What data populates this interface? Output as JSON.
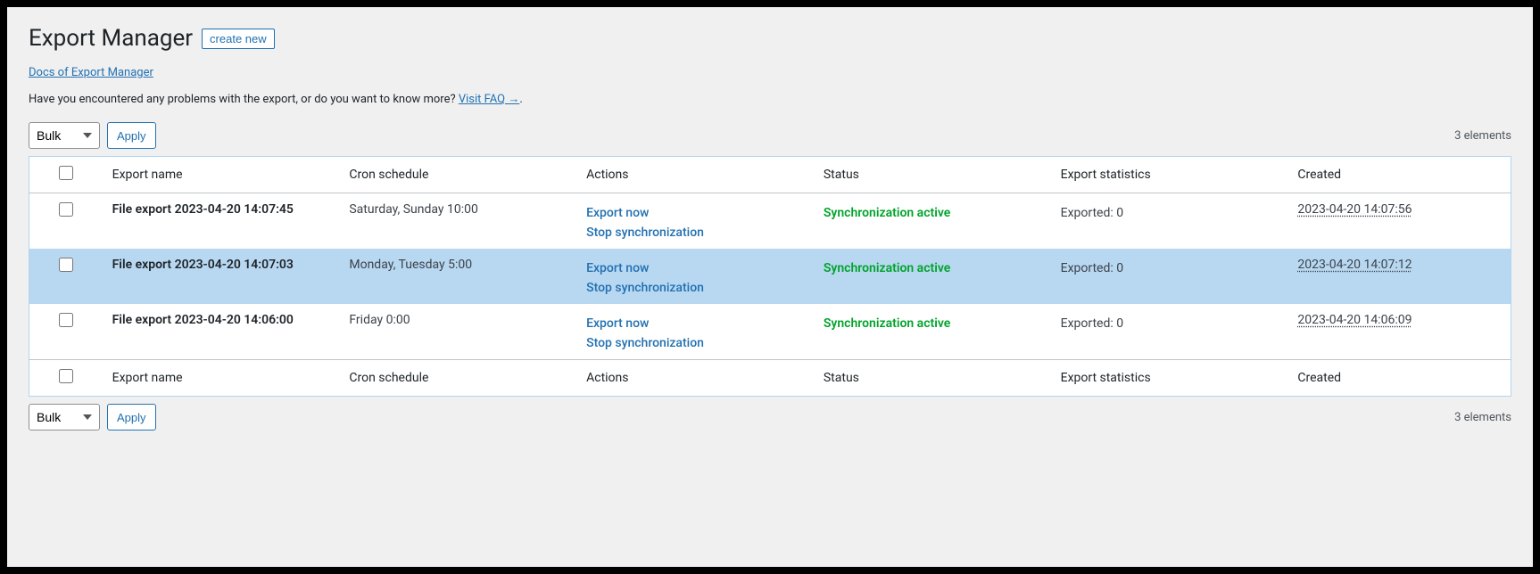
{
  "page": {
    "title": "Export Manager",
    "create_new_label": "create new",
    "docs_link": "Docs of Export Manager",
    "faq_prefix": "Have you encountered any problems with the export, or do you want to know more? ",
    "faq_link": "Visit FAQ →",
    "faq_suffix": "."
  },
  "toolbar": {
    "bulk_label": "Bulk",
    "apply_label": "Apply",
    "count_label": "3 elements"
  },
  "table": {
    "headers": {
      "export_name": "Export name",
      "cron": "Cron schedule",
      "actions": "Actions",
      "status": "Status",
      "stats": "Export statistics",
      "created": "Created"
    },
    "rows": [
      {
        "name": "File export 2023-04-20 14:07:45",
        "cron": "Saturday, Sunday 10:00",
        "action_export": "Export now",
        "action_stop": "Stop synchronization",
        "status": "Synchronization active",
        "stats": "Exported: 0",
        "created": "2023-04-20 14:07:56",
        "highlighted": false
      },
      {
        "name": "File export 2023-04-20 14:07:03",
        "cron": "Monday, Tuesday 5:00",
        "action_export": "Export now",
        "action_stop": "Stop synchronization",
        "status": "Synchronization active",
        "stats": "Exported: 0",
        "created": "2023-04-20 14:07:12",
        "highlighted": true
      },
      {
        "name": "File export 2023-04-20 14:06:00",
        "cron": "Friday 0:00",
        "action_export": "Export now",
        "action_stop": "Stop synchronization",
        "status": "Synchronization active",
        "stats": "Exported: 0",
        "created": "2023-04-20 14:06:09",
        "highlighted": false
      }
    ]
  }
}
